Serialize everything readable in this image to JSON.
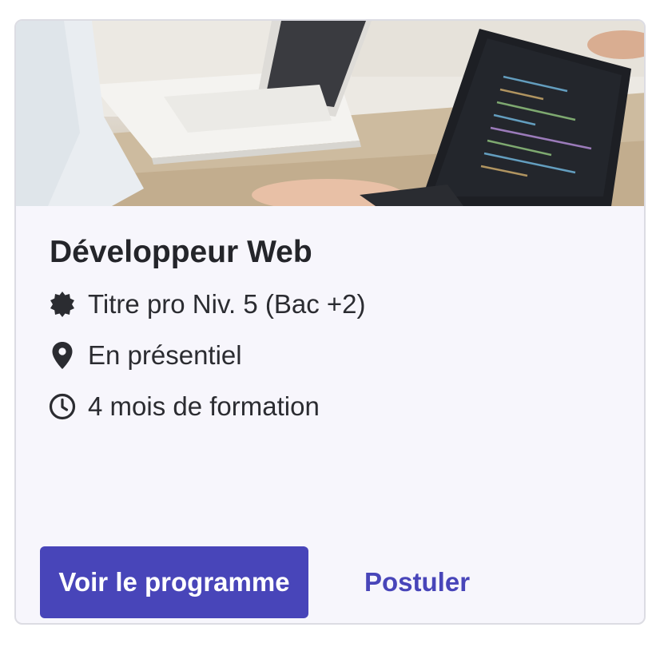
{
  "course": {
    "title": "Développeur Web",
    "image_alt": "",
    "details": [
      {
        "icon": "badge-icon",
        "text": "Titre pro Niv. 5 (Bac +2)"
      },
      {
        "icon": "location-pin-icon",
        "text": "En présentiel"
      },
      {
        "icon": "clock-icon",
        "text": "4 mois de formation"
      }
    ]
  },
  "actions": {
    "primary_label": "Voir le programme",
    "secondary_label": "Postuler"
  },
  "colors": {
    "accent": "#4845b9",
    "card_background": "#f7f6fc",
    "text": "#24252a"
  }
}
